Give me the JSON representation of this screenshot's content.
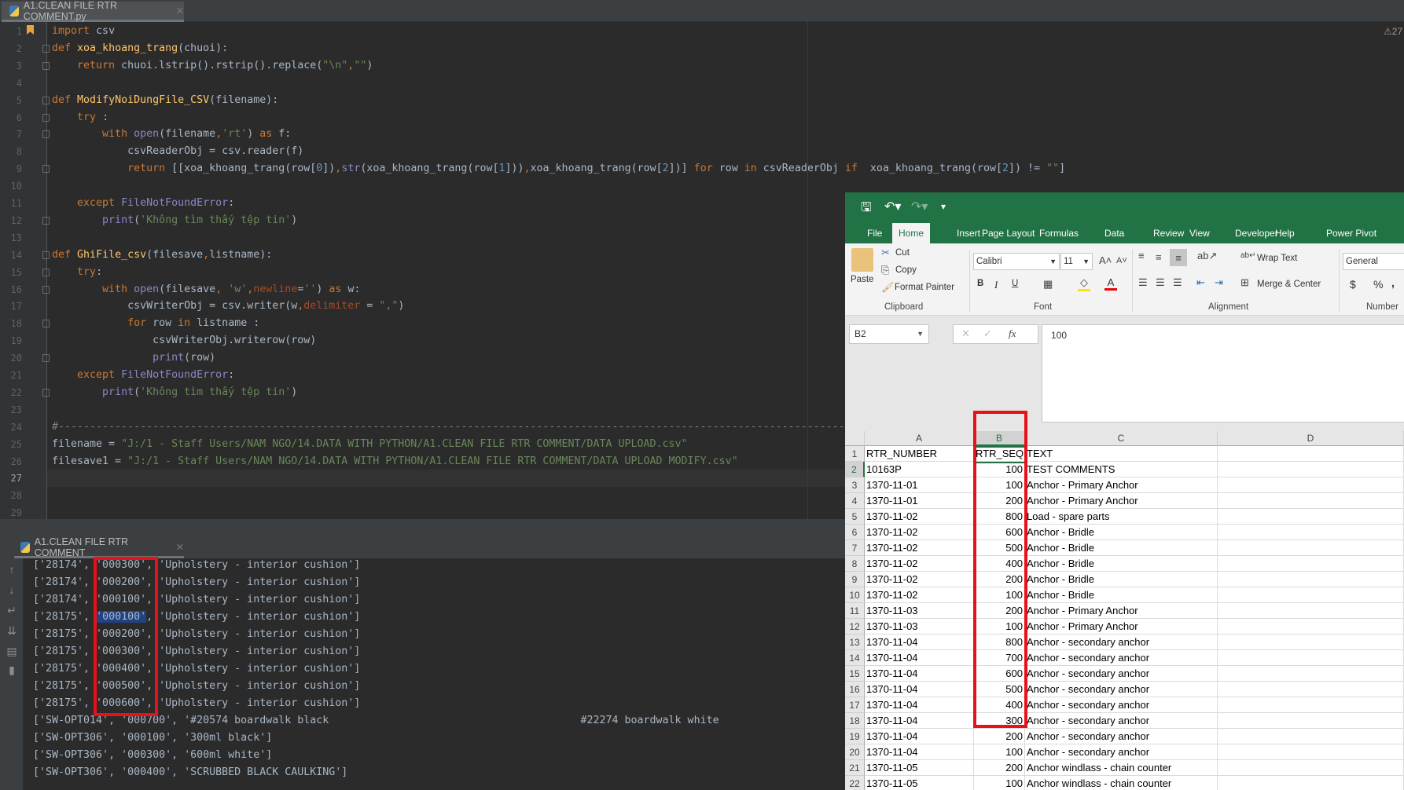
{
  "editor": {
    "tab_label": "A1.CLEAN FILE RTR COMMENT.py",
    "warning_count": "27",
    "current_line": 27,
    "lines": [
      [
        [
          "import",
          "kw"
        ],
        [
          " csv",
          "txt"
        ]
      ],
      [
        [
          "def",
          "kw"
        ],
        [
          " ",
          "txt"
        ],
        [
          "xoa_khoang_trang",
          "fn"
        ],
        [
          "(chuoi):",
          "txt"
        ]
      ],
      [
        [
          "    ",
          "txt"
        ],
        [
          "return",
          "kw"
        ],
        [
          " chuoi.lstrip().rstrip().replace(",
          "txt"
        ],
        [
          "\"\\n\"",
          "str"
        ],
        [
          ",",
          "kw"
        ],
        [
          "\"\"",
          "str"
        ],
        [
          ")",
          "txt"
        ]
      ],
      [],
      [
        [
          "def",
          "kw"
        ],
        [
          " ",
          "txt"
        ],
        [
          "ModifyNoiDungFile_CSV",
          "fn"
        ],
        [
          "(filename):",
          "txt"
        ]
      ],
      [
        [
          "    ",
          "txt"
        ],
        [
          "try",
          "kw"
        ],
        [
          " :",
          "txt"
        ]
      ],
      [
        [
          "        ",
          "txt"
        ],
        [
          "with",
          "kw"
        ],
        [
          " ",
          "txt"
        ],
        [
          "open",
          "bi"
        ],
        [
          "(filename",
          "txt"
        ],
        [
          ",",
          "kw"
        ],
        [
          "'rt'",
          "str"
        ],
        [
          ") ",
          "txt"
        ],
        [
          "as",
          "kw"
        ],
        [
          " f:",
          "txt"
        ]
      ],
      [
        [
          "            csvReaderObj = csv.reader(f)",
          "txt"
        ]
      ],
      [
        [
          "            ",
          "txt"
        ],
        [
          "return",
          "kw"
        ],
        [
          " [[xoa_khoang_trang(row[",
          "txt"
        ],
        [
          "0",
          "num"
        ],
        [
          "])",
          "txt"
        ],
        [
          ",",
          "kw"
        ],
        [
          "str",
          "bi"
        ],
        [
          "(xoa_khoang_trang(row[",
          "txt"
        ],
        [
          "1",
          "num"
        ],
        [
          "]))",
          "txt"
        ],
        [
          ",",
          "kw"
        ],
        [
          "xoa_khoang_trang(row[",
          "txt"
        ],
        [
          "2",
          "num"
        ],
        [
          "])] ",
          "txt"
        ],
        [
          "for",
          "kw"
        ],
        [
          " row ",
          "txt"
        ],
        [
          "in",
          "kw"
        ],
        [
          " csvReaderObj ",
          "txt"
        ],
        [
          "if",
          "kw"
        ],
        [
          "  xoa_khoang_trang(row[",
          "txt"
        ],
        [
          "2",
          "num"
        ],
        [
          "]) != ",
          "txt"
        ],
        [
          "\"\"",
          "str"
        ],
        [
          "]",
          "txt"
        ]
      ],
      [],
      [
        [
          "    ",
          "txt"
        ],
        [
          "except",
          "kw"
        ],
        [
          " ",
          "txt"
        ],
        [
          "FileNotFoundError",
          "bi"
        ],
        [
          ":",
          "txt"
        ]
      ],
      [
        [
          "        ",
          "txt"
        ],
        [
          "print",
          "bi"
        ],
        [
          "(",
          "txt"
        ],
        [
          "'Không tìm thấy tệp tin'",
          "str"
        ],
        [
          ")",
          "txt"
        ]
      ],
      [],
      [
        [
          "def",
          "kw"
        ],
        [
          " ",
          "txt"
        ],
        [
          "GhiFile_csv",
          "fn"
        ],
        [
          "(filesave",
          "txt"
        ],
        [
          ",",
          "kw"
        ],
        [
          "listname):",
          "txt"
        ]
      ],
      [
        [
          "    ",
          "txt"
        ],
        [
          "try",
          "kw"
        ],
        [
          ":",
          "txt"
        ]
      ],
      [
        [
          "        ",
          "txt"
        ],
        [
          "with",
          "kw"
        ],
        [
          " ",
          "txt"
        ],
        [
          "open",
          "bi"
        ],
        [
          "(filesave",
          "txt"
        ],
        [
          ",",
          "kw"
        ],
        [
          " ",
          "txt"
        ],
        [
          "'w'",
          "str"
        ],
        [
          ",",
          "kw"
        ],
        [
          "newline",
          "par"
        ],
        [
          "=",
          "txt"
        ],
        [
          "''",
          "str"
        ],
        [
          ") ",
          "txt"
        ],
        [
          "as",
          "kw"
        ],
        [
          " w:",
          "txt"
        ]
      ],
      [
        [
          "            csvWriterObj = csv.writer(w",
          "txt"
        ],
        [
          ",",
          "kw"
        ],
        [
          "delimiter",
          "par"
        ],
        [
          " = ",
          "txt"
        ],
        [
          "\",\"",
          "str"
        ],
        [
          ")",
          "txt"
        ]
      ],
      [
        [
          "            ",
          "txt"
        ],
        [
          "for",
          "kw"
        ],
        [
          " row ",
          "txt"
        ],
        [
          "in",
          "kw"
        ],
        [
          " listname :",
          "txt"
        ]
      ],
      [
        [
          "                csvWriterObj.writerow(row)",
          "txt"
        ]
      ],
      [
        [
          "                ",
          "txt"
        ],
        [
          "print",
          "bi"
        ],
        [
          "(row)",
          "txt"
        ]
      ],
      [
        [
          "    ",
          "txt"
        ],
        [
          "except",
          "kw"
        ],
        [
          " ",
          "txt"
        ],
        [
          "FileNotFoundError",
          "bi"
        ],
        [
          ":",
          "txt"
        ]
      ],
      [
        [
          "        ",
          "txt"
        ],
        [
          "print",
          "bi"
        ],
        [
          "(",
          "txt"
        ],
        [
          "'Không tìm thấy tệp tin'",
          "str"
        ],
        [
          ")",
          "txt"
        ]
      ],
      [],
      [
        [
          "#------------------------------------------------------------------------------------------------------------------------------------",
          "cm"
        ]
      ],
      [
        [
          "filename = ",
          "txt"
        ],
        [
          "\"J:/1 - Staff Users/NAM NGO/14.DATA WITH PYTHON/A1.CLEAN FILE RTR COMMENT/DATA UPLOAD.csv\"",
          "str"
        ]
      ],
      [
        [
          "filesave1 = ",
          "txt"
        ],
        [
          "\"J:/1 - Staff Users/NAM NGO/14.DATA WITH PYTHON/A1.CLEAN FILE RTR COMMENT/DATA UPLOAD MODIFY.csv\"",
          "str"
        ]
      ],
      [],
      [],
      []
    ]
  },
  "console": {
    "tab_label": "A1.CLEAN FILE RTR COMMENT",
    "lines": [
      [
        [
          "['28174', '000300', 'Upholstery - interior cushion']",
          "txt"
        ]
      ],
      [
        [
          "['28174', '000200', 'Upholstery - interior cushion']",
          "txt"
        ]
      ],
      [
        [
          "['28174', '000100', 'Upholstery - interior cushion']",
          "txt"
        ]
      ],
      [
        [
          "['28175', ",
          "txt"
        ],
        [
          "'000100'",
          "sel"
        ],
        [
          ", 'Upholstery - interior cushion']",
          "txt"
        ]
      ],
      [
        [
          "['28175', '000200', 'Upholstery - interior cushion']",
          "txt"
        ]
      ],
      [
        [
          "['28175', '000300', 'Upholstery - interior cushion']",
          "txt"
        ]
      ],
      [
        [
          "['28175', '000400', 'Upholstery - interior cushion']",
          "txt"
        ]
      ],
      [
        [
          "['28175', '000500', 'Upholstery - interior cushion']",
          "txt"
        ]
      ],
      [
        [
          "['28175', '000600', 'Upholstery - interior cushion']",
          "txt"
        ]
      ],
      [
        [
          "['SW-OPT014', '000700', '#20574 boardwalk black                                        #22274 boardwalk white",
          "txt"
        ]
      ],
      [
        [
          "['SW-OPT306', '000100', '300ml black']",
          "txt"
        ]
      ],
      [
        [
          "['SW-OPT306', '000300', '600ml white']",
          "txt"
        ]
      ],
      [
        [
          "['SW-OPT306', '000400', 'SCRUBBED BLACK CAULKING']",
          "txt"
        ]
      ]
    ]
  },
  "excel": {
    "accent": "#217346",
    "highlight_color": "#e8101a",
    "tabs": [
      "File",
      "Home",
      "Insert",
      "Page Layout",
      "Formulas",
      "Data",
      "Review",
      "View",
      "Developer",
      "Help",
      "Power Pivot"
    ],
    "active_tab": "Home",
    "clipboard": {
      "paste": "Paste",
      "cut": "Cut",
      "copy": "Copy",
      "format_painter": "Format Painter",
      "label": "Clipboard"
    },
    "font": {
      "name": "Calibri",
      "size": "11",
      "bold": "B",
      "italic": "I",
      "underline": "U",
      "label": "Font"
    },
    "alignment": {
      "wrap_text": "Wrap Text",
      "merge_center": "Merge & Center",
      "label": "Alignment"
    },
    "number": {
      "format": "General",
      "currency": "$",
      "percent": "%",
      "comma": ",",
      "label": "Number"
    },
    "name_box": "B2",
    "formula_value": "100",
    "fx": "fx",
    "columns": [
      "A",
      "B",
      "C",
      "D"
    ],
    "selected_cell": "B2",
    "rows": [
      [
        "1",
        "RTR_NUMBER",
        "RTR_SEQ",
        "TEXT"
      ],
      [
        "2",
        "10163P",
        "100",
        "TEST COMMENTS"
      ],
      [
        "3",
        "1370-11-01",
        "100",
        "Anchor - Primary Anchor"
      ],
      [
        "4",
        "1370-11-01",
        "200",
        "Anchor - Primary Anchor"
      ],
      [
        "5",
        "1370-11-02",
        "800",
        "Load - spare parts"
      ],
      [
        "6",
        "1370-11-02",
        "600",
        "Anchor - Bridle"
      ],
      [
        "7",
        "1370-11-02",
        "500",
        "Anchor - Bridle"
      ],
      [
        "8",
        "1370-11-02",
        "400",
        "Anchor - Bridle"
      ],
      [
        "9",
        "1370-11-02",
        "200",
        "Anchor - Bridle"
      ],
      [
        "10",
        "1370-11-02",
        "100",
        "Anchor - Bridle"
      ],
      [
        "11",
        "1370-11-03",
        "200",
        "Anchor - Primary Anchor"
      ],
      [
        "12",
        "1370-11-03",
        "100",
        "Anchor - Primary Anchor"
      ],
      [
        "13",
        "1370-11-04",
        "800",
        "Anchor - secondary anchor"
      ],
      [
        "14",
        "1370-11-04",
        "700",
        "Anchor - secondary anchor"
      ],
      [
        "15",
        "1370-11-04",
        "600",
        "Anchor - secondary anchor"
      ],
      [
        "16",
        "1370-11-04",
        "500",
        "Anchor - secondary anchor"
      ],
      [
        "17",
        "1370-11-04",
        "400",
        "Anchor - secondary anchor"
      ],
      [
        "18",
        "1370-11-04",
        "300",
        "Anchor - secondary anchor"
      ],
      [
        "19",
        "1370-11-04",
        "200",
        "Anchor - secondary anchor"
      ],
      [
        "20",
        "1370-11-04",
        "100",
        "Anchor - secondary anchor"
      ],
      [
        "21",
        "1370-11-05",
        "200",
        "Anchor windlass - chain counter"
      ],
      [
        "22",
        "1370-11-05",
        "100",
        "Anchor windlass - chain counter"
      ]
    ]
  }
}
